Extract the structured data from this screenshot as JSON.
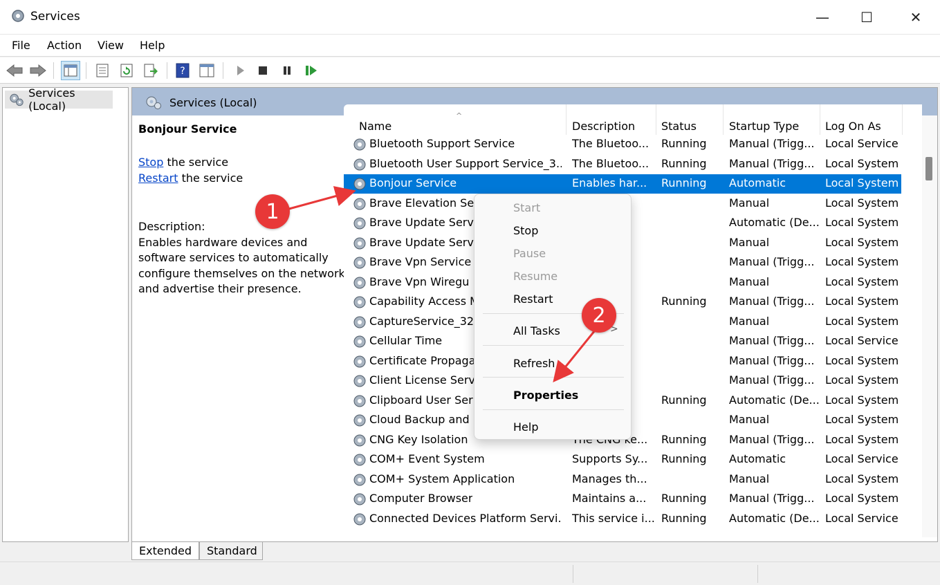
{
  "window": {
    "title": "Services",
    "min_glyph": "—",
    "max_glyph": "☐",
    "close_glyph": "✕"
  },
  "menu": [
    "File",
    "Action",
    "View",
    "Help"
  ],
  "tree": {
    "item": "Services (Local)"
  },
  "pane": {
    "header": "Services (Local)"
  },
  "detail": {
    "title": "Bonjour Service",
    "stop_link": "Stop",
    "stop_rest": " the service",
    "restart_link": "Restart",
    "restart_rest": " the service",
    "desc_label": "Description:",
    "desc_text": "Enables hardware devices and software services to automatically configure themselves on the network and advertise their presence."
  },
  "columns": [
    "Name",
    "Description",
    "Status",
    "Startup Type",
    "Log On As"
  ],
  "rows": [
    {
      "name": "Bluetooth Support Service",
      "desc": "The Bluetoo...",
      "status": "Running",
      "startup": "Manual (Trigg...",
      "logon": "Local Service"
    },
    {
      "name": "Bluetooth User Support Service_3...",
      "desc": "The Bluetoo...",
      "status": "Running",
      "startup": "Manual (Trigg...",
      "logon": "Local System"
    },
    {
      "name": "Bonjour Service",
      "desc": "Enables har...",
      "status": "Running",
      "startup": "Automatic",
      "logon": "Local System"
    },
    {
      "name": "Brave Elevation Se",
      "desc": "",
      "status": "",
      "startup": "Manual",
      "logon": "Local System"
    },
    {
      "name": "Brave Update Serv",
      "desc": "...",
      "status": "",
      "startup": "Automatic (De...",
      "logon": "Local System"
    },
    {
      "name": "Brave Update Serv",
      "desc": "...",
      "status": "",
      "startup": "Manual",
      "logon": "Local System"
    },
    {
      "name": "Brave Vpn Service",
      "desc": "...",
      "status": "",
      "startup": "Manual (Trigg...",
      "logon": "Local System"
    },
    {
      "name": "Brave Vpn Wiregu",
      "desc": "",
      "status": "",
      "startup": "Manual",
      "logon": "Local System"
    },
    {
      "name": "Capability Access M",
      "desc": "ci...",
      "status": "Running",
      "startup": "Manual (Trigg...",
      "logon": "Local System"
    },
    {
      "name": "CaptureService_32",
      "desc": "ti...",
      "status": "",
      "startup": "Manual",
      "logon": "Local System"
    },
    {
      "name": "Cellular Time",
      "desc": "...",
      "status": "",
      "startup": "Manual (Trigg...",
      "logon": "Local Service"
    },
    {
      "name": "Certificate Propaga",
      "desc": "r ...",
      "status": "",
      "startup": "Manual (Trigg...",
      "logon": "Local System"
    },
    {
      "name": "Client License Serv",
      "desc": "fr...",
      "status": "",
      "startup": "Manual (Trigg...",
      "logon": "Local System"
    },
    {
      "name": "Clipboard User Ser",
      "desc": "er...",
      "status": "Running",
      "startup": "Automatic (De...",
      "logon": "Local System"
    },
    {
      "name": "Cloud Backup and",
      "desc": "n...",
      "status": "",
      "startup": "Manual",
      "logon": "Local System"
    },
    {
      "name": "CNG Key Isolation",
      "desc": "The CNG ke...",
      "status": "Running",
      "startup": "Manual (Trigg...",
      "logon": "Local System"
    },
    {
      "name": "COM+ Event System",
      "desc": "Supports Sy...",
      "status": "Running",
      "startup": "Automatic",
      "logon": "Local Service"
    },
    {
      "name": "COM+ System Application",
      "desc": "Manages th...",
      "status": "",
      "startup": "Manual",
      "logon": "Local System"
    },
    {
      "name": "Computer Browser",
      "desc": "Maintains a...",
      "status": "Running",
      "startup": "Manual (Trigg...",
      "logon": "Local System"
    },
    {
      "name": "Connected Devices Platform Servi...",
      "desc": "This service i...",
      "status": "Running",
      "startup": "Automatic (De...",
      "logon": "Local Service"
    }
  ],
  "selected_row": 2,
  "tabs": [
    "Extended",
    "Standard"
  ],
  "context_menu": {
    "start": "Start",
    "stop": "Stop",
    "pause": "Pause",
    "resume": "Resume",
    "restart": "Restart",
    "all_tasks": "All Tasks",
    "submenu_arrow": ">",
    "refresh": "Refresh",
    "properties": "Properties",
    "help": "Help"
  },
  "annotations": {
    "badge1": "1",
    "badge2": "2"
  },
  "colors": {
    "selection": "#0078d7",
    "header_band": "#a9bcd6",
    "badge": "#e83838",
    "link": "#0645c8"
  },
  "icons": [
    "gear-icon",
    "back-arrow-icon",
    "forward-arrow-icon",
    "console-tree-icon",
    "properties-icon",
    "refresh-icon",
    "export-list-icon",
    "help-icon",
    "show-hide-icon",
    "play-icon",
    "stop-icon",
    "pause-icon",
    "resume-icon"
  ]
}
